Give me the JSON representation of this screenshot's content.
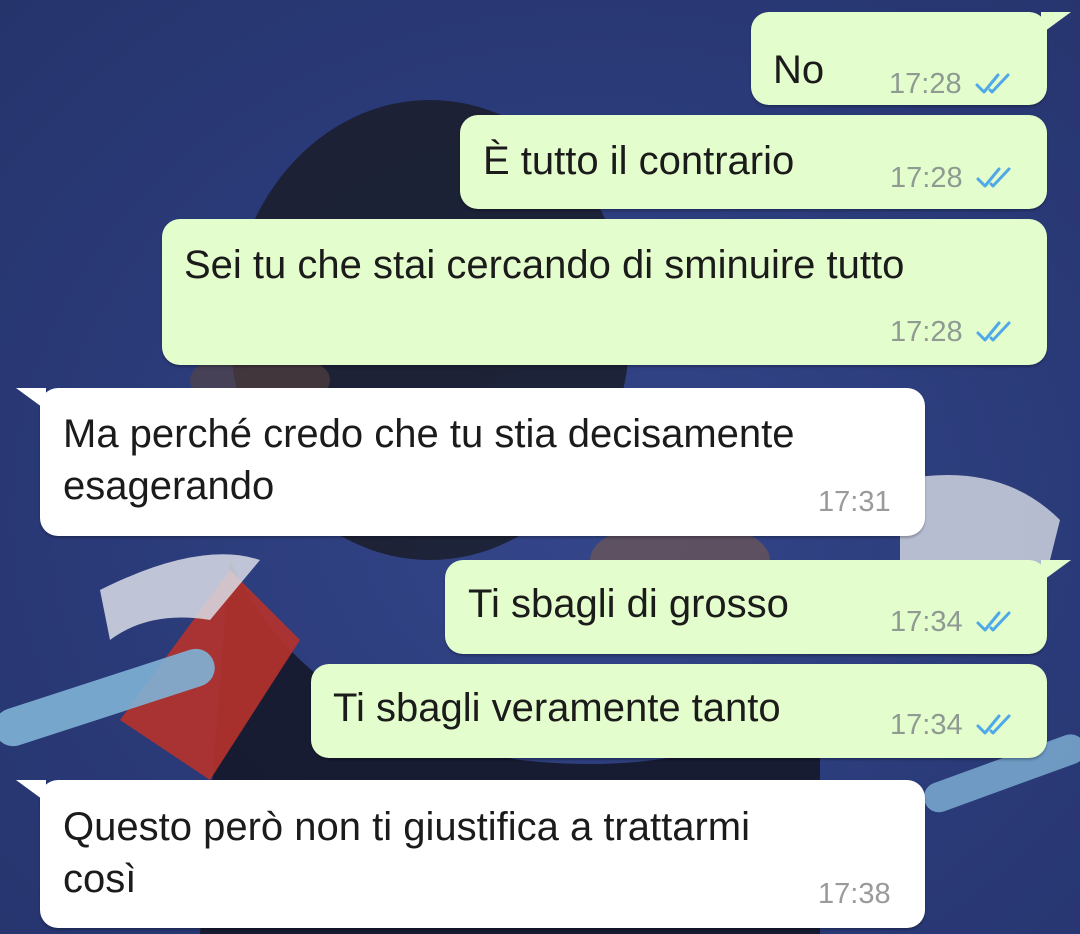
{
  "messages": [
    {
      "text": "No",
      "time": "17:28"
    },
    {
      "text": "È tutto il contrario",
      "time": "17:28"
    },
    {
      "text": "Sei tu che stai cercando di sminuire tutto",
      "time": "17:28"
    },
    {
      "line1": "Ma perché credo che tu stia decisamente",
      "line2": "esagerando",
      "time": "17:31"
    },
    {
      "text": "Ti sbagli di grosso",
      "time": "17:34"
    },
    {
      "text": "Ti sbagli veramente tanto",
      "time": "17:34"
    },
    {
      "line1": "Questo però non ti giustifica a trattarmi",
      "line2": "così",
      "time": "17:38"
    }
  ],
  "colors": {
    "outgoing_bubble": "#e4fdcc",
    "incoming_bubble": "#ffffff",
    "read_ticks": "#4fa8e8",
    "wallpaper": "#2c3d80"
  },
  "icons": {
    "read_status": "double-check-icon"
  }
}
